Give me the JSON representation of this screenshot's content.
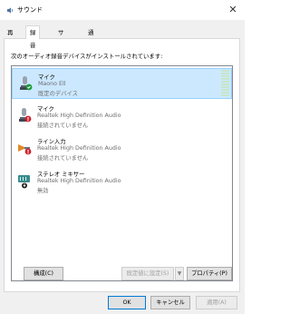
{
  "window": {
    "title": "サウンド",
    "close_glyph": "✕"
  },
  "tabs": [
    {
      "label": "再生",
      "selected": false
    },
    {
      "label": "録音",
      "selected": true
    },
    {
      "label": "サウンド",
      "selected": false
    },
    {
      "label": "通信",
      "selected": false
    }
  ],
  "panel": {
    "prompt": "次のオーディオ録音デバイスがインストールされています:",
    "devices": [
      {
        "name": "マイク",
        "line1": "Maono Ell",
        "line2": "既定のデバイス",
        "selected": true,
        "icon": "microphone-icon",
        "status": "default-check",
        "status_color": "#1a9c3a"
      },
      {
        "name": "マイク",
        "line1": "Realtek High Definition Audio",
        "line2": "接続されていません",
        "selected": false,
        "icon": "microphone-icon",
        "status": "disconnected",
        "status_color": "#d1202a"
      },
      {
        "name": "ライン入力",
        "line1": "Realtek High Definition Audio",
        "line2": "接続されていません",
        "selected": false,
        "icon": "line-in-icon",
        "status": "disconnected",
        "status_color": "#d1202a"
      },
      {
        "name": "ステレオ ミキサー",
        "line1": "Realtek High Definition Audio",
        "line2": "無効",
        "selected": false,
        "icon": "stereo-mixer-icon",
        "status": "disabled",
        "status_color": "#333333"
      }
    ]
  },
  "buttons": {
    "configure": "構成(C)",
    "set_default": "既定値に設定(S)",
    "set_default_arrow": "▼",
    "properties": "プロパティ(P)",
    "ok": "OK",
    "cancel": "キャンセル",
    "apply": "適用(A)"
  },
  "colors": {
    "accent": "#0078d7",
    "selection": "#cce8ff",
    "level_meter": "#c8e6c9"
  }
}
